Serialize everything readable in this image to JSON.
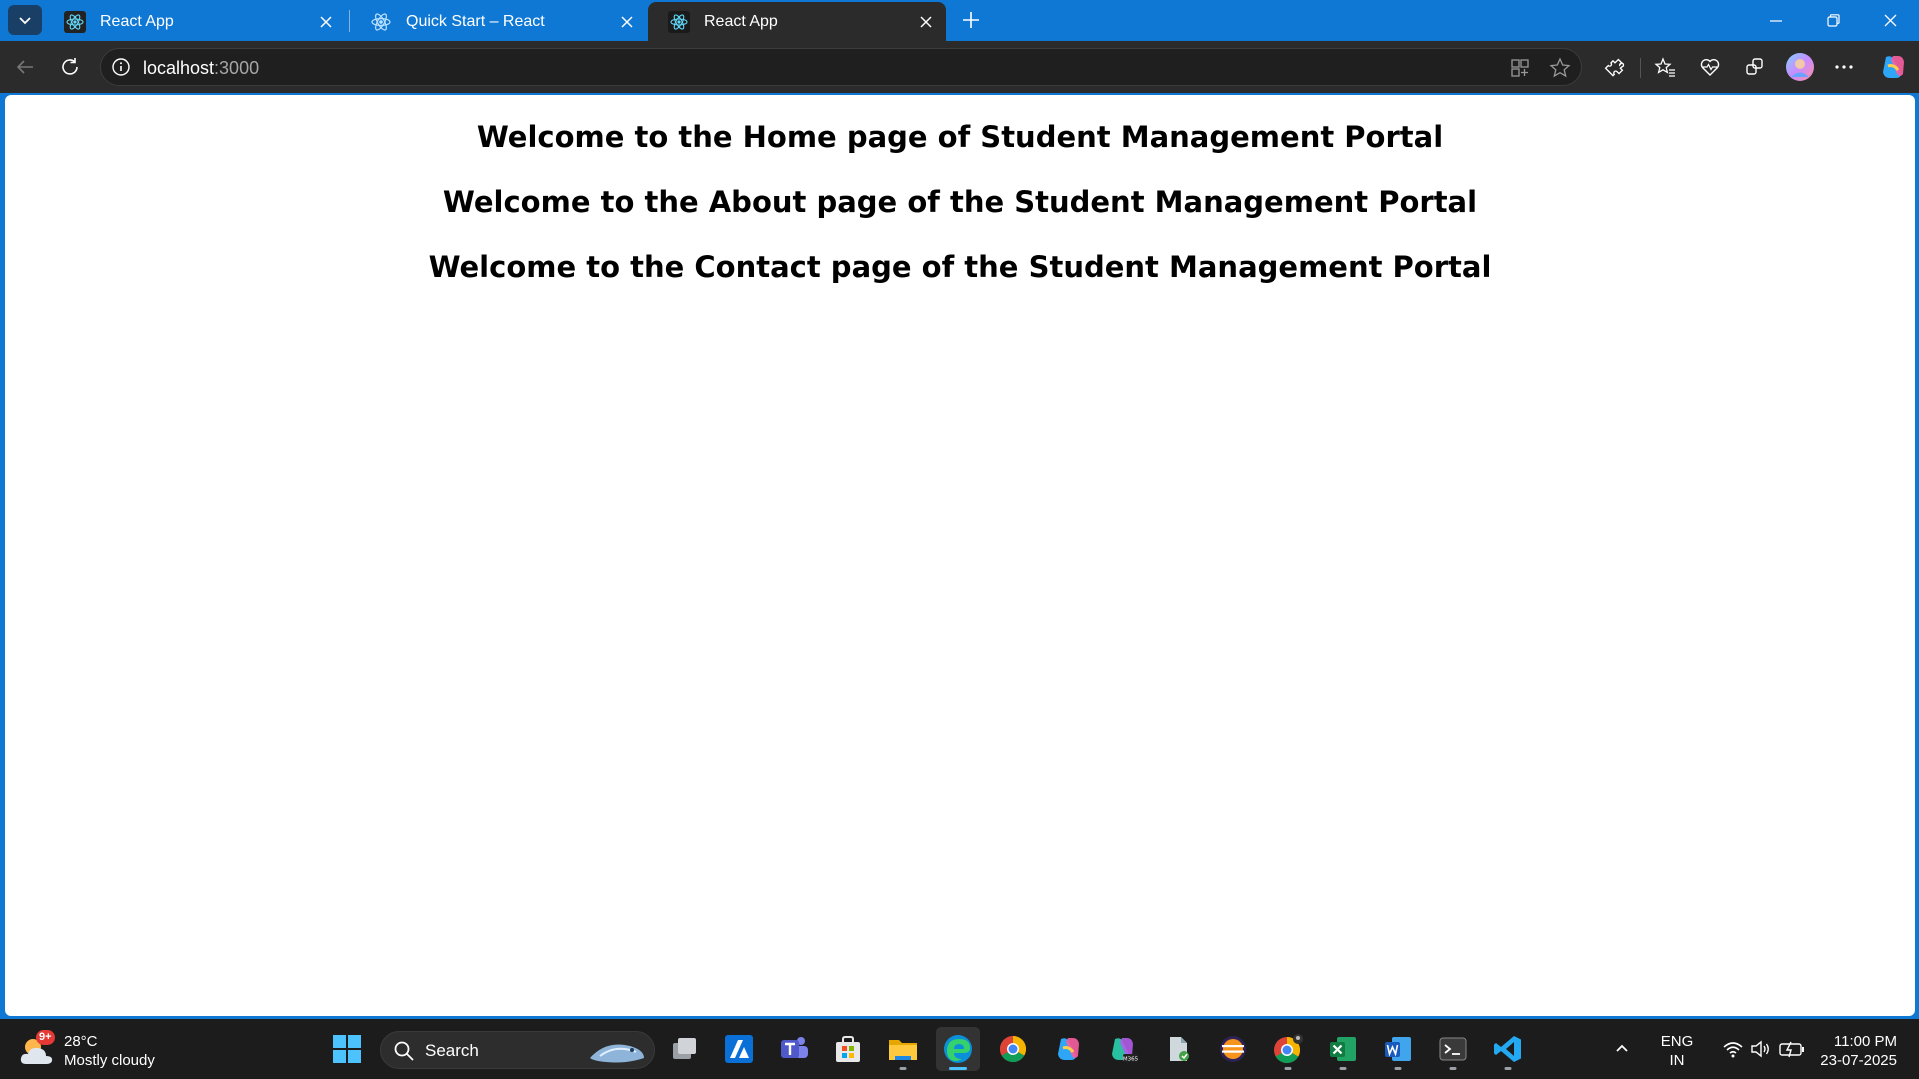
{
  "browser": {
    "tabs": [
      {
        "label": "React App",
        "icon": "react-icon",
        "active": false
      },
      {
        "label": "Quick Start – React",
        "icon": "react-icon",
        "active": false
      },
      {
        "label": "React App",
        "icon": "react-icon",
        "active": true
      }
    ],
    "address": {
      "host": "localhost",
      "port": ":3000"
    },
    "accent": "#0f78d4"
  },
  "page": {
    "headings": [
      "Welcome to the Home page of Student Management Portal",
      "Welcome to the About page of the Student Management Portal",
      "Welcome to the Contact page of the Student Management Portal"
    ]
  },
  "taskbar": {
    "weather": {
      "badge": "9+",
      "temp": "28°C",
      "condition": "Mostly cloudy"
    },
    "search_label": "Search",
    "language": {
      "line1": "ENG",
      "line2": "IN"
    },
    "clock": {
      "time": "11:00 PM",
      "date": "23-07-2025"
    },
    "apps": [
      "task-view",
      "azure",
      "teams",
      "microsoft-store",
      "file-explorer",
      "edge",
      "chrome",
      "copilot",
      "m365",
      "file-app",
      "eclipse",
      "chrome-profile",
      "excel",
      "word",
      "terminal",
      "vscode"
    ]
  }
}
